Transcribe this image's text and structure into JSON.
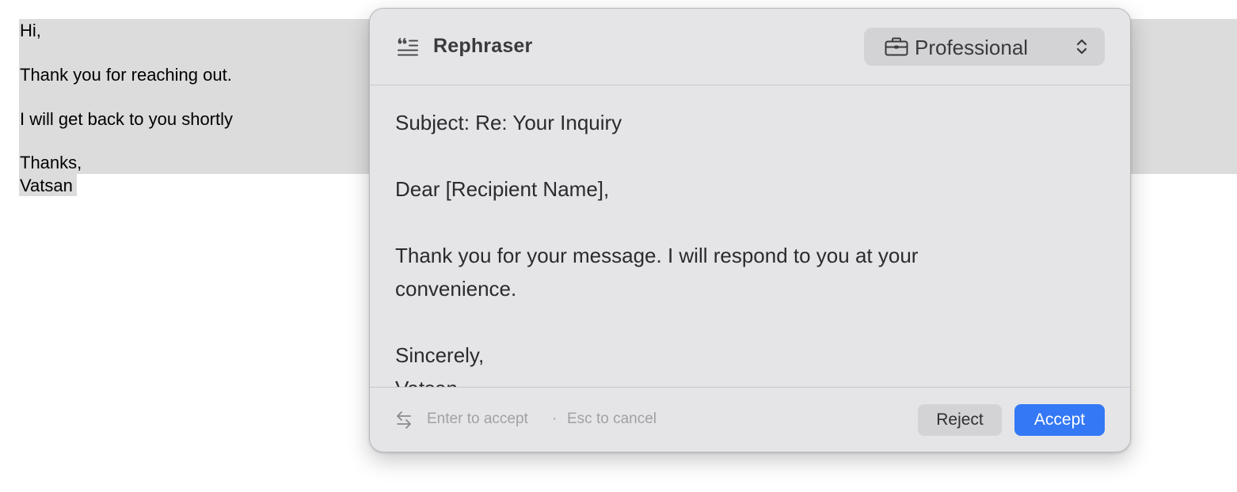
{
  "document": {
    "lines": [
      "Hi,",
      "Thank you for reaching out.",
      "I will get back to you shortly",
      "Thanks,",
      "Vatsan"
    ]
  },
  "rephraser": {
    "title": "Rephraser",
    "title_icon": "quote-lines-icon",
    "tone": {
      "selected": "Professional",
      "icon": "briefcase-icon",
      "chevron_icon": "up-down-chevron-icon"
    },
    "result_text": "Subject: Re: Your Inquiry\n\nDear [Recipient Name],\n\nThank you for your message. I will respond to you at your convenience.\n\nSincerely,\nVatsan",
    "footer": {
      "icon": "swap-arrows-icon",
      "hint_accept": "Enter to accept",
      "hint_separator": "·",
      "hint_cancel": "Esc to cancel",
      "reject_label": "Reject",
      "accept_label": "Accept"
    }
  },
  "colors": {
    "accent": "#3478f6",
    "selection": "#dcdcdc",
    "popup_bg": "#e5e5e8"
  }
}
